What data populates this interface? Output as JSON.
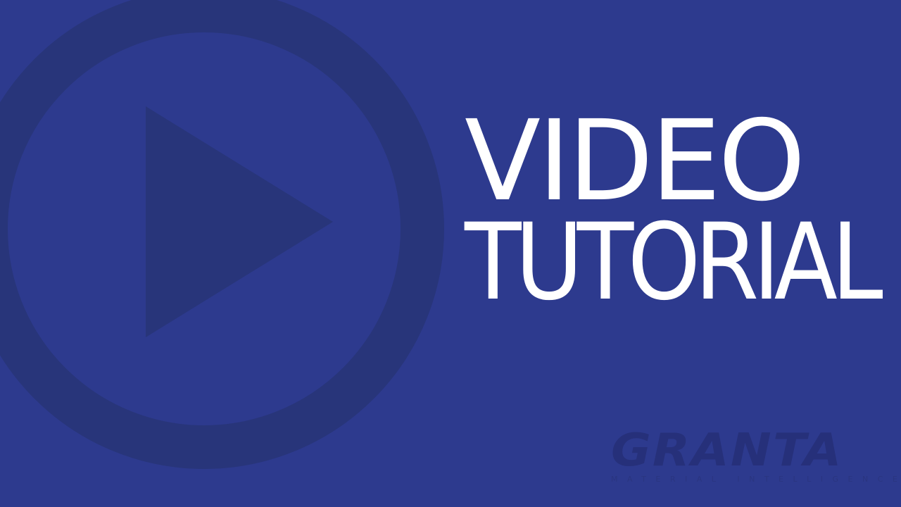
{
  "title": {
    "line1": "VIDEO",
    "line2": "TUTORIAL"
  },
  "brand": {
    "name": "GRANTA",
    "tagline": "MATERIAL INTELLIGENCE"
  },
  "graphic": {
    "icon": "play-circle-icon"
  },
  "colors": {
    "background": "#2d3a8e",
    "graphic": "#28357a",
    "text": "#ffffff",
    "brand": "#26307a"
  }
}
